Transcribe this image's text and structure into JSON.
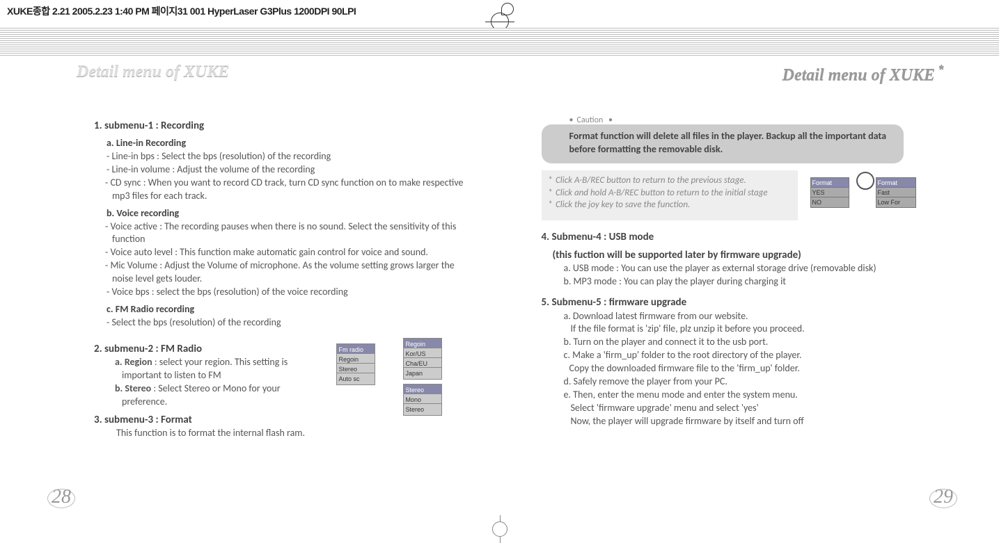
{
  "meta_top": "XUKE종합 2.21 2005.2.23 1:40 PM 페이지31  001 HyperLaser G3Plus 1200DPI 90LPI",
  "heading_left": "Detail menu of XUKE",
  "heading_right": "Detail menu of XUKE",
  "left": {
    "s1": "1. submenu-1 : Recording",
    "s1a": "a. Line-in Recording",
    "s1a1": "- Line-in bps : Select the bps (resolution) of the recording",
    "s1a2": "- Line-in volume : Adjust the volume of the recording",
    "s1a3": "- CD sync : When you want to record CD track, turn CD sync function on to make respective mp3 files for each track.",
    "s1b": "b. Voice recording",
    "s1b1": "- Voice active : The recording pauses when there is no sound. Select the sensitivity of this function",
    "s1b2": "- Voice auto level : This function make automatic gain control for voice and sound.",
    "s1b3": "- Mic Volume : Adjust the Volume of microphone. As the volume setting grows larger the noise level gets louder.",
    "s1b4": "- Voice bps : select the bps (resolution) of the voice recording",
    "s1c": "c. FM Radio recording",
    "s1c1": "- Select the bps (resolution) of the recording",
    "s2": "2. submenu-2 : FM Radio",
    "s2a_b": "a. Region",
    "s2a_t": " : select your region. This setting is important to listen to FM",
    "s2b_b": "b. Stereo",
    "s2b_t": " : Select Stereo or Mono for your preference.",
    "s3": "3. submenu-3 : Format",
    "s3a": "This function is to format the internal flash ram.",
    "ui": {
      "fmradio": "Fm radio",
      "regoin": "Regoin",
      "stereo": "Stereo",
      "autosc": "Auto sc",
      "regoin2": "Regoin",
      "korus": "Kor/US",
      "chaeu": "Cha/EU",
      "japan": "Japan",
      "stereo2": "Stereo",
      "mono": "Mono",
      "stereo3": "Stereo"
    }
  },
  "right": {
    "caution_label": "Caution",
    "caution_text": "Format function will delete all files in the player. Backup all the important data before formatting the removable disk.",
    "tip1": "Click A-B/REC button to return to the previous stage.",
    "tip2": "Click and hold A-B/REC button to return to the initial stage",
    "tip3": "Click the joy key to save the function.",
    "thumb": {
      "format1": "Format",
      "yes": "YES",
      "no": "NO",
      "format2": "Format",
      "fast": "Fast",
      "lowfor": "Low For"
    },
    "s4": "4. Submenu-4 : USB mode",
    "s4sub": "(this fuction will be supported later by firmware upgrade)",
    "s4a": "a. USB mode : You can use the player as external storage drive (removable disk)",
    "s4b": "b. MP3 mode : You can play the player during charging it",
    "s5": "5. Submenu-5 : firmware upgrade",
    "s5a": "a. Download latest firmware from our website.",
    "s5a2": "If the file format is 'zip' file, plz unzip it before you proceed.",
    "s5b": "b. Turn on the player and connect it to the usb port.",
    "s5c": "c. Make a 'firm_up' folder to the root directory of the player.",
    "s5c2": "Copy the downloaded firmware file to the 'firm_up' folder.",
    "s5d": "d. Safely remove the player from your PC.",
    "s5e": "e. Then, enter the menu mode and enter the system menu.",
    "s5e2": "Select 'firmware upgrade' menu and select 'yes'",
    "s5e3": "Now, the player will upgrade firmware by itself and turn off"
  },
  "page_left": "28",
  "page_right": "29"
}
